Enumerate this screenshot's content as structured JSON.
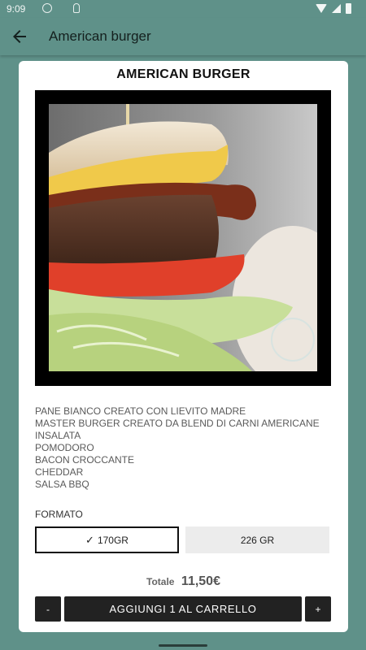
{
  "status_bar": {
    "time": "9:09"
  },
  "app_bar": {
    "back_icon": "arrow-left-icon",
    "title": "American burger"
  },
  "product": {
    "title": "AMERICAN BURGER",
    "image_icon": "burger-photo",
    "ingredients": [
      "PANE BIANCO CREATO CON LIEVITO MADRE",
      "MASTER BURGER CREATO DA BLEND DI CARNI AMERICANE",
      "INSALATA",
      "POMODORO",
      "BACON CROCCANTE",
      "CHEDDAR",
      "SALSA BBQ"
    ]
  },
  "format": {
    "label": "FORMATO",
    "options": [
      {
        "label": "170GR",
        "selected": true,
        "check": "✓"
      },
      {
        "label": "226 GR",
        "selected": false
      }
    ]
  },
  "total": {
    "label": "Totale",
    "value": "11,50€"
  },
  "actions": {
    "minus": "-",
    "add_to_cart": "AGGIUNGI 1 AL CARRELLO",
    "plus": "+"
  },
  "colors": {
    "background": "#5f9189",
    "card": "#ffffff",
    "button": "#222222"
  }
}
